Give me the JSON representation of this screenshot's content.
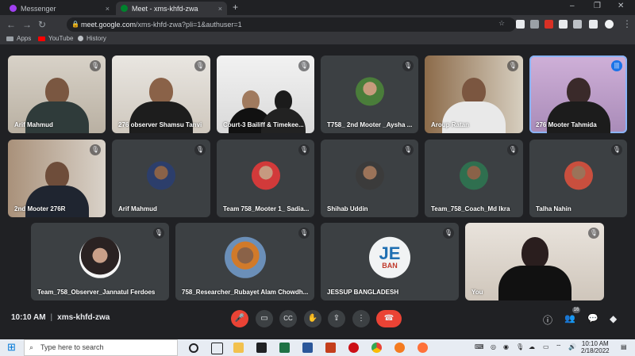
{
  "browser": {
    "tabs": [
      {
        "title": "Messenger",
        "close": "×",
        "color": "#a040f0"
      },
      {
        "title": "Meet - xms-khfd-zwa",
        "close": "×",
        "color": "#00832d"
      }
    ],
    "new_tab": "+",
    "window_controls": [
      "–",
      "❐",
      "✕"
    ],
    "url_host": "meet.google.com",
    "url_path": "/xms-khfd-zwa?pli=1&authuser=1",
    "bookmarks": [
      {
        "label": "Apps",
        "color": "#9aa0a6"
      },
      {
        "label": "YouTube",
        "color": "#ff0000"
      },
      {
        "label": "History",
        "color": "#bdc1c6"
      }
    ]
  },
  "participants": [
    {
      "name": "Arif Mahmud",
      "muted": true,
      "type": "video"
    },
    {
      "name": "276 observer Shamsu Tanvi",
      "muted": true,
      "type": "video"
    },
    {
      "name": "Court-3 Bailiff & Timekee...",
      "muted": true,
      "type": "video"
    },
    {
      "name": "T758_ 2nd Mooter _Aysha ...",
      "muted": true,
      "type": "avatar"
    },
    {
      "name": "Aroup Ratan",
      "muted": true,
      "type": "video"
    },
    {
      "name": "276 Mooter Tahmida",
      "muted": false,
      "speaking": true,
      "type": "video"
    },
    {
      "name": "2nd Mooter 276R",
      "muted": true,
      "type": "video"
    },
    {
      "name": "Arif Mahmud",
      "muted": true,
      "type": "avatar"
    },
    {
      "name": "Team 758_Mooter 1_ Sadia...",
      "muted": true,
      "type": "avatar"
    },
    {
      "name": "Shihab Uddin",
      "muted": true,
      "type": "avatar"
    },
    {
      "name": "Team_758_Coach_Md Ikra",
      "muted": true,
      "type": "avatar"
    },
    {
      "name": "Talha Nahin",
      "muted": true,
      "type": "avatar"
    },
    {
      "name": "Team_758_Observer_Jannatul Ferdoes",
      "muted": true,
      "type": "avatar"
    },
    {
      "name": "758_Researcher_Rubayet Alam Chowdh...",
      "muted": true,
      "type": "avatar"
    },
    {
      "name": "JESSUP BANGLADESH",
      "muted": false,
      "type": "logo",
      "logo_text": "JE",
      "logo_sub": "BAN"
    },
    {
      "name": "You",
      "muted": true,
      "type": "video"
    }
  ],
  "meeting": {
    "time": "10:10 AM",
    "separator": "|",
    "code": "xms-khfd-zwa",
    "participant_count": "16"
  },
  "controls": {
    "mic": "🎤",
    "camera": "▭",
    "captions": "CC",
    "raise_hand": "✋",
    "present": "⇪",
    "more": "⋮",
    "hangup": "☎",
    "info": "ⓘ",
    "people": "👥",
    "chat": "💬",
    "activities": "◆"
  },
  "taskbar": {
    "start": "⊞",
    "search_placeholder": "Type here to search",
    "time": "10:10 AM",
    "date": "2/18/2022"
  },
  "colors": {
    "accent": "#8ab4f8",
    "danger": "#ea4335",
    "tile_bg": "#3c4043"
  }
}
